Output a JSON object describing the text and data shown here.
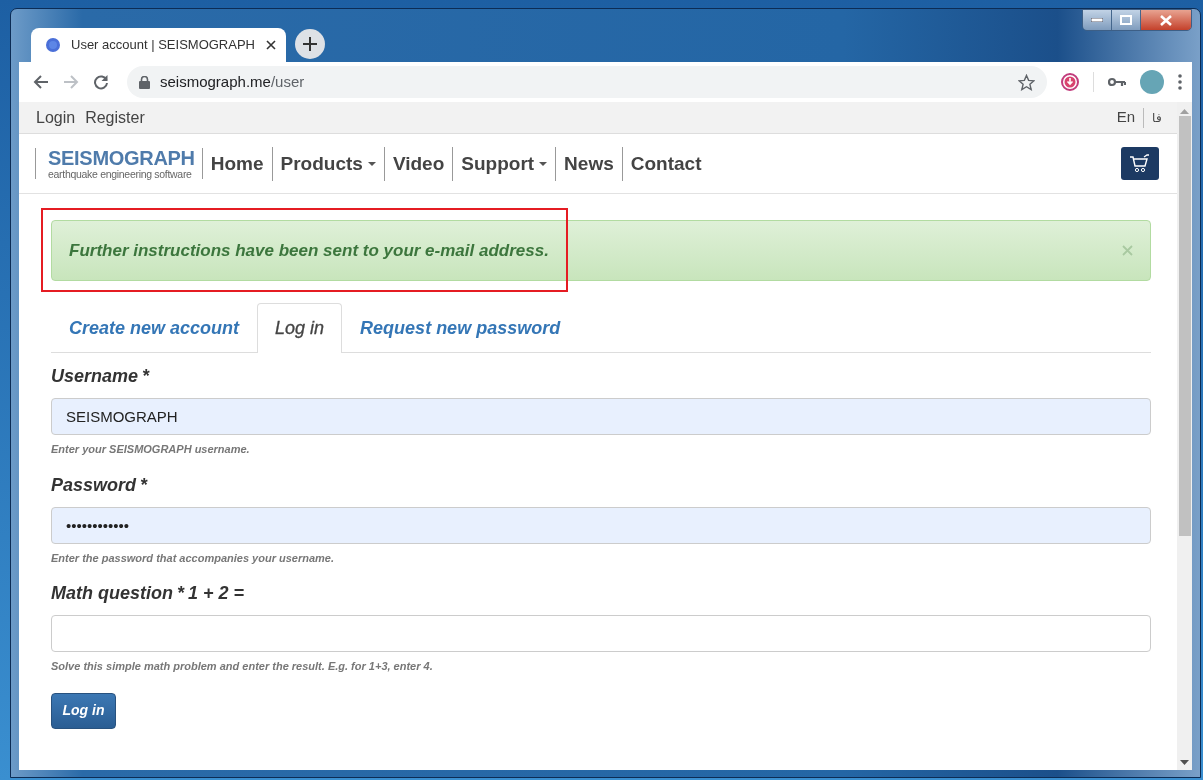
{
  "browser": {
    "tabs": [
      {
        "title": "User account | SEISMOGRAPH",
        "selected": true
      }
    ],
    "url": {
      "host": "seismograph.me",
      "path": "/user"
    }
  },
  "top_bar": {
    "links": [
      "Login",
      "Register"
    ],
    "languages": [
      "En",
      "فا"
    ]
  },
  "site": {
    "logo": {
      "name": "SEISMOGRAPH",
      "tagline": "earthquake engineering software"
    },
    "nav": [
      {
        "label": "Home",
        "has_menu": false
      },
      {
        "label": "Products",
        "has_menu": true
      },
      {
        "label": "Video",
        "has_menu": false
      },
      {
        "label": "Support",
        "has_menu": true
      },
      {
        "label": "News",
        "has_menu": false
      },
      {
        "label": "Contact",
        "has_menu": false
      }
    ]
  },
  "alert": {
    "message": "Further instructions have been sent to your e-mail address.",
    "highlighted": true
  },
  "form": {
    "tabs": [
      {
        "label": "Create new account",
        "selected": false
      },
      {
        "label": "Log in",
        "selected": true
      },
      {
        "label": "Request new password",
        "selected": false
      }
    ],
    "required_mark": "*",
    "fields": [
      {
        "label": "Username",
        "required": true,
        "value": "SEISMOGRAPH",
        "autofilled": true,
        "help": "Enter your SEISMOGRAPH username."
      },
      {
        "label": "Password",
        "required": true,
        "value": "••••••••••••",
        "autofilled": true,
        "help": "Enter the password that accompanies your username."
      },
      {
        "label": "Math question",
        "required": true,
        "suffix": "1 + 2 =",
        "autofilled": false,
        "help": "Solve this simple math problem and enter the result. E.g. for 1+3, enter 4."
      }
    ],
    "submit": "Log in"
  }
}
